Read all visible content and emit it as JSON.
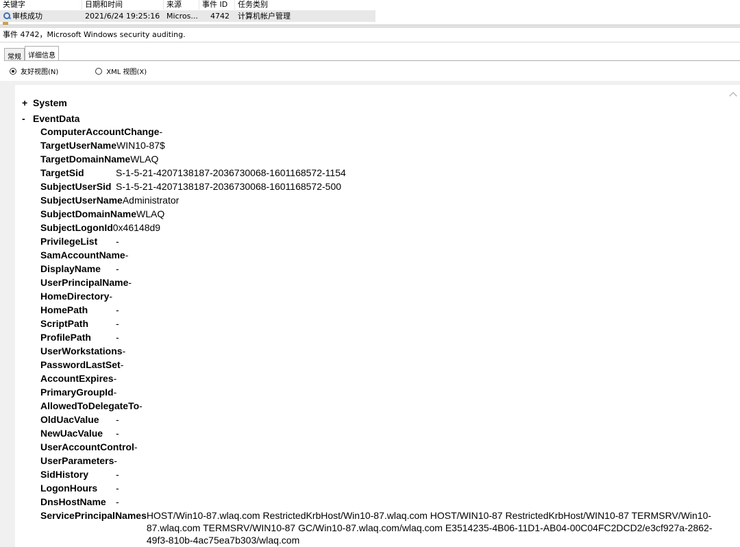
{
  "list": {
    "headers": [
      "关键字",
      "日期和时间",
      "来源",
      "事件 ID",
      "任务类别"
    ],
    "row": {
      "keyword": "审核成功",
      "datetime": "2021/6/24 19:25:16",
      "source": "Micros...",
      "event_id": "4742",
      "task_category": "计算机帐户管理"
    }
  },
  "event_title": "事件 4742，Microsoft Windows security auditing.",
  "tabs": [
    "常规",
    "详细信息"
  ],
  "view": {
    "friendly_label": "友好视图(N)",
    "xml_label": "XML 视图(X)",
    "selected": "friendly"
  },
  "tree": {
    "system": {
      "toggle": "+",
      "label": "System"
    },
    "eventdata": {
      "toggle": "-",
      "label": "EventData"
    }
  },
  "fields": [
    {
      "name": "ComputerAccountChange",
      "value": "-"
    },
    {
      "name": "TargetUserName",
      "value": "WIN10-87$"
    },
    {
      "name": "TargetDomainName",
      "value": "WLAQ"
    },
    {
      "name": "TargetSid",
      "value": "S-1-5-21-4207138187-2036730068-1601168572-1154"
    },
    {
      "name": "SubjectUserSid",
      "value": "S-1-5-21-4207138187-2036730068-1601168572-500"
    },
    {
      "name": "SubjectUserName",
      "value": "Administrator"
    },
    {
      "name": "SubjectDomainName",
      "value": "WLAQ"
    },
    {
      "name": "SubjectLogonId",
      "value": "0x46148d9"
    },
    {
      "name": "PrivilegeList",
      "value": "-"
    },
    {
      "name": "SamAccountName",
      "value": "-"
    },
    {
      "name": "DisplayName",
      "value": "-"
    },
    {
      "name": "UserPrincipalName",
      "value": "-"
    },
    {
      "name": "HomeDirectory",
      "value": "-"
    },
    {
      "name": "HomePath",
      "value": "-"
    },
    {
      "name": "ScriptPath",
      "value": "-"
    },
    {
      "name": "ProfilePath",
      "value": "-"
    },
    {
      "name": "UserWorkstations",
      "value": "-"
    },
    {
      "name": "PasswordLastSet",
      "value": "-"
    },
    {
      "name": "AccountExpires",
      "value": "-"
    },
    {
      "name": "PrimaryGroupId",
      "value": "-"
    },
    {
      "name": "AllowedToDelegateTo",
      "value": "-"
    },
    {
      "name": "OldUacValue",
      "value": "-"
    },
    {
      "name": "NewUacValue",
      "value": "-"
    },
    {
      "name": "UserAccountControl",
      "value": "-"
    },
    {
      "name": "UserParameters",
      "value": "-"
    },
    {
      "name": "SidHistory",
      "value": "-"
    },
    {
      "name": "LogonHours",
      "value": "-"
    },
    {
      "name": "DnsHostName",
      "value": "-"
    },
    {
      "name": "ServicePrincipalNames",
      "value": "HOST/Win10-87.wlaq.com RestrictedKrbHost/Win10-87.wlaq.com HOST/WIN10-87 RestrictedKrbHost/WIN10-87 TERMSRV/Win10-87.wlaq.com TERMSRV/WIN10-87 GC/Win10-87.wlaq.com/wlaq.com E3514235-4B06-11D1-AB04-00C04FC2DCD2/e3cf927a-2862-49f3-810b-4ac75ea7b303/wlaq.com"
    }
  ]
}
